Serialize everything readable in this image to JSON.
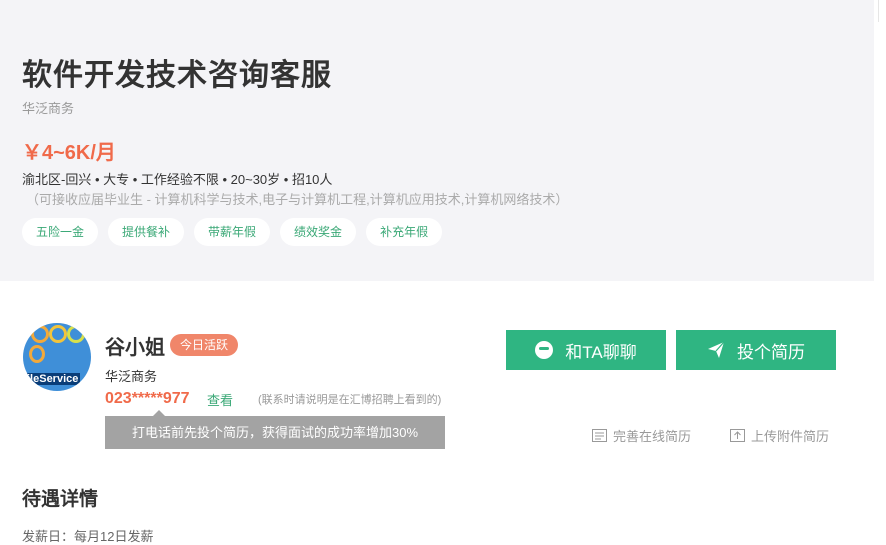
{
  "job": {
    "title": "软件开发技术咨询客服",
    "company": "华泛商务",
    "salary": "￥4~6K/月",
    "meta": "渝北区-回兴 • 大专 • 工作经验不限 • 20~30岁 • 招10人",
    "majors": "（可接收应届毕业生 - 计算机科学与技术,电子与计算机工程,计算机应用技术,计算机网络技术）",
    "tags": [
      "五险一金",
      "提供餐补",
      "带薪年假",
      "绩效奖金",
      "补充年假"
    ]
  },
  "contact": {
    "avatar_text": "ileService",
    "name": "谷小姐",
    "badge": "今日活跃",
    "company": "华泛商务",
    "phone": "023*****977",
    "view_label": "查看",
    "phone_note": "(联系时请说明是在汇博招聘上看到的)",
    "tooltip": "打电话前先投个简历，获得面试的成功率增加30%"
  },
  "actions": {
    "chat_label": "和TA聊聊",
    "apply_label": "投个简历",
    "complete_resume": "完善在线简历",
    "upload_resume": "上传附件简历"
  },
  "benefits": {
    "title": "待遇详情",
    "payday": "发薪日：每月12日发薪"
  },
  "colors": {
    "accent_green": "#2fb582",
    "salary_orange": "#f06a4a",
    "badge_orange": "#f0866a"
  }
}
